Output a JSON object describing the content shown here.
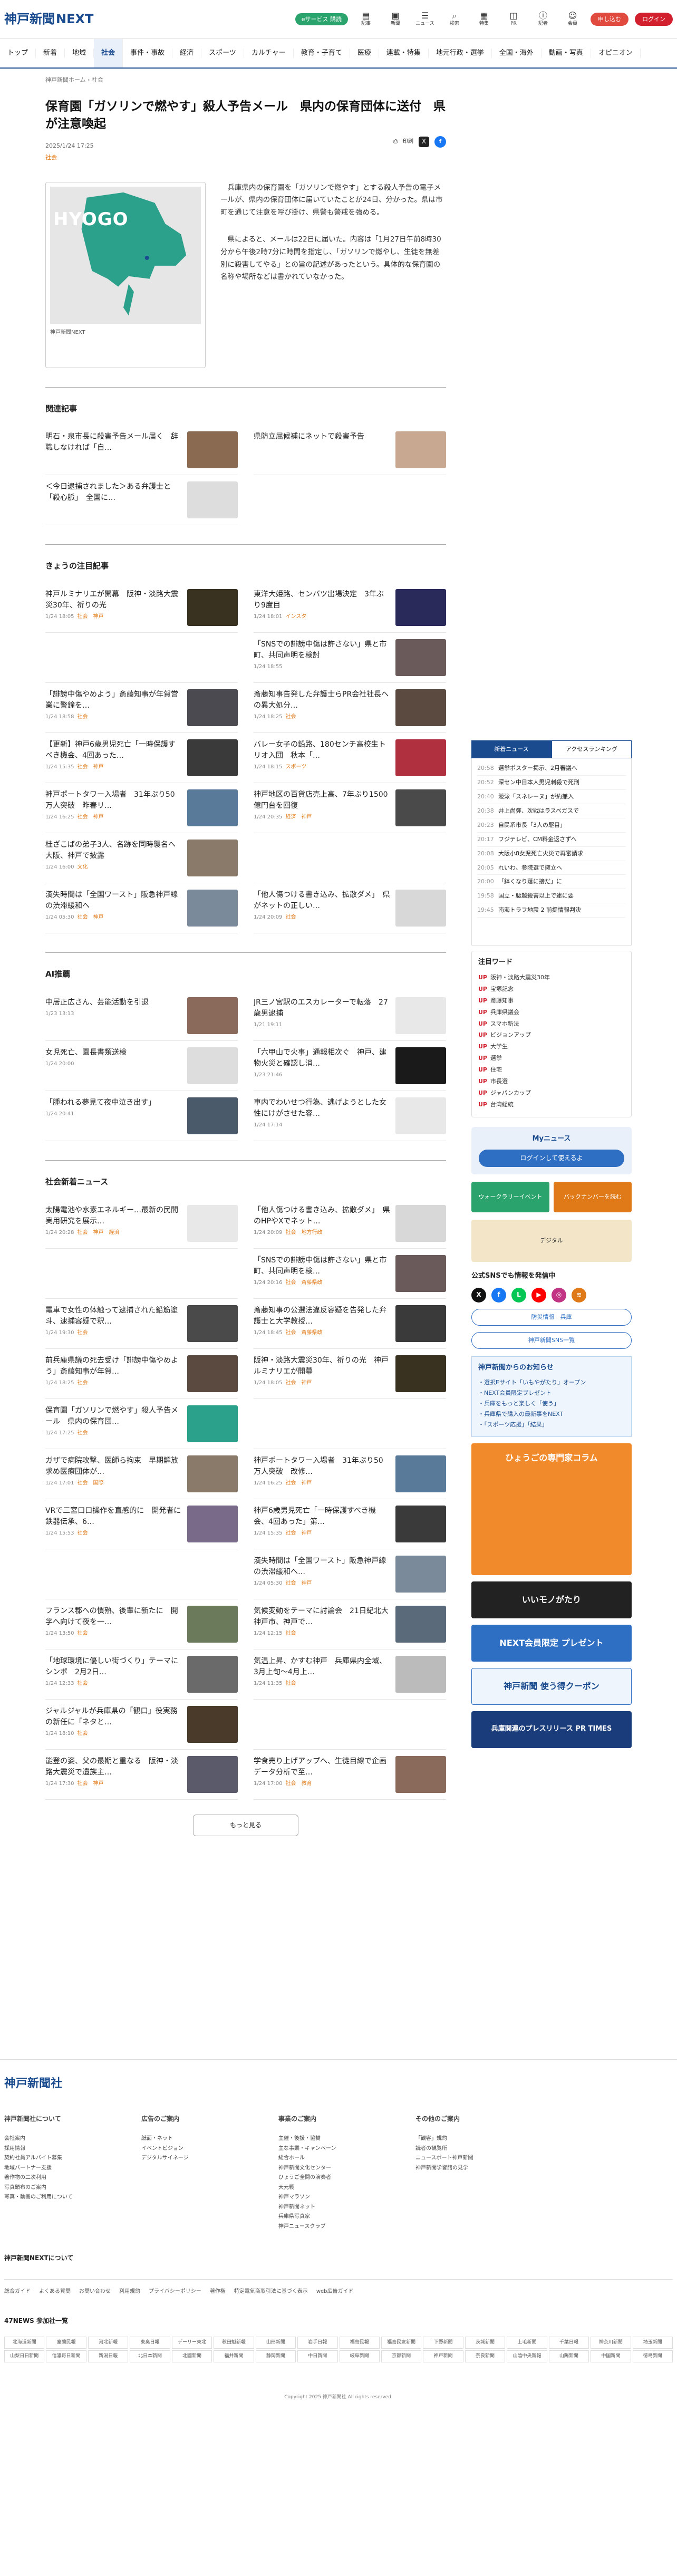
{
  "site": {
    "logo_jp": "神戸新聞",
    "logo_en": "NEXT",
    "eservice": "eサービス 購読"
  },
  "header_icons": [
    "記事",
    "新聞",
    "ニュース",
    "検索",
    "特集",
    "PR",
    "記者",
    "会員"
  ],
  "header_labels": {
    "subscribe": "申し込む",
    "login": "ログイン"
  },
  "nav": [
    "トップ",
    "新着",
    "地域",
    "社会",
    "事件・事故",
    "経済",
    "スポーツ",
    "カルチャー",
    "教育・子育て",
    "医療",
    "連載・特集",
    "地元行政・選挙",
    "全国・海外",
    "動画・写真",
    "オピニオン"
  ],
  "breadcrumb": "神戸新聞ホーム › 社会",
  "article": {
    "title": "保育園「ガソリンで燃やす」殺人予告メール　県内の保育団体に送付　県が注意喚起",
    "date": "2025/1/24 17:25",
    "category": "社会",
    "map_label": "HYOGO",
    "caption": "神戸新聞NEXT",
    "p1": "兵庫県内の保育園を「ガソリンで燃やす」とする殺人予告の電子メールが、県内の保育団体に届いていたことが24日、分かった。県は市町を通じて注意を呼び掛け、県警も警戒を強める。",
    "p2": "県によると、メールは22日に届いた。内容は「1月27日午前8時30分から午後2時7分に時間を指定し、「ガソリンで燃やし、生徒を無差別に殺害してやる」との旨の記述があったという。具体的な保育園の名称や場所などは書かれていなかった。"
  },
  "share_labels": {
    "print": "印刷",
    "x": "X",
    "fb": "f"
  },
  "sections": {
    "related": "関連記事",
    "today": "きょうの注目記事",
    "ai": "AI推薦",
    "social": "社会新着ニュース"
  },
  "related": [
    {
      "title": "明石・泉市長に殺害予告メール届く　辞職しなければ「自…",
      "meta": "",
      "thumb": "#8a6a50"
    },
    {
      "title": "県防立屈候補にネットで殺害予告",
      "meta": "",
      "thumb": "#c8a890"
    },
    {
      "title": "＜今日逮捕されました＞ある弁護士と「殺心脈」　全国に…",
      "meta": "",
      "thumb": "#dddddd"
    }
  ],
  "today": [
    {
      "title": "神戸ルミナリエが開幕　阪神・淡路大震災30年、祈りの光",
      "meta": "1/24 18:05",
      "cat": "社会　神戸",
      "thumb": "#3a3220"
    },
    {
      "title": "東洋大姫路、センバツ出場決定　3年ぶり9度目",
      "meta": "1/24 18:01",
      "cat": "インスタ",
      "thumb": "#2a2a5a"
    },
    {
      "title": "",
      "meta": "",
      "cat": "",
      "thumb": ""
    },
    {
      "title": "「SNSでの誹謗中傷は許さない」県と市町、共同声明を検討",
      "meta": "1/24 18:55",
      "cat": "",
      "thumb": "#6a5a5a"
    },
    {
      "title": "「誹謗中傷やめよう」斎藤知事が年賀営業に警鐘を…",
      "meta": "1/24 18:58",
      "cat": "社会",
      "thumb": "#4a4a50"
    },
    {
      "title": "斎藤知事告発した弁護士らPR会社社長への異大処分…",
      "meta": "1/24 18:25",
      "cat": "社会",
      "thumb": "#5a4a40"
    },
    {
      "title": "【更新】神戸6歳男児死亡「一時保護すべき機会、4回あった…",
      "meta": "1/24 15:35",
      "cat": "社会　神戸",
      "thumb": "#3a3a3a"
    },
    {
      "title": "バレー女子の鉛路、180センチ高校生トリオ入団　秋本「…",
      "meta": "1/24 18:15",
      "cat": "スポーツ",
      "thumb": "#b03040"
    },
    {
      "title": "神戸ポートタワー入場者　31年ぶり50万人突破　昨春リ…",
      "meta": "1/24 16:25",
      "cat": "社会　神戸",
      "thumb": "#5a7a9a"
    },
    {
      "title": "神戸地区の百貨店売上高、7年ぶり1500億円台を回復",
      "meta": "1/24 20:35",
      "cat": "経済　神戸",
      "thumb": "#4a4a4a"
    },
    {
      "title": "桂ざこばの弟子3人、名跡を同時襲名へ　大阪、神戸で披露",
      "meta": "1/24 16:00",
      "cat": "文化",
      "thumb": "#8a7a6a"
    },
    {
      "title": "",
      "meta": "",
      "cat": "",
      "thumb": ""
    },
    {
      "title": "漢失時間は「全国ワースト」阪急神戸線の渋滞緩和へ",
      "meta": "1/24 05:30",
      "cat": "社会　神戸",
      "thumb": "#7a8a9a"
    },
    {
      "title": "「他人傷つける書き込み、拡散ダメ」　県がネットの正しい…",
      "meta": "1/24 20:09",
      "cat": "社会",
      "thumb": "#d8d8d8"
    }
  ],
  "ai": [
    {
      "title": "中居正広さん、芸能活動を引退",
      "meta": "1/23 13:13",
      "cat": "",
      "thumb": "#8a6a5a"
    },
    {
      "title": "JR三ノ宮駅のエスカレーターで転落　27歳男逮捕",
      "meta": "1/21 19:11",
      "cat": "",
      "thumb": "#e8e8e8"
    },
    {
      "title": "女児死亡、園長書類送検",
      "meta": "1/24 20:00",
      "cat": "",
      "thumb": "#dddddd"
    },
    {
      "title": "「六甲山で火事」通報相次ぐ　神戸、建物火災と確認し消…",
      "meta": "1/23 21:46",
      "cat": "",
      "thumb": "#1a1a1a"
    },
    {
      "title": "「腫われる夢見て夜中泣き出す」",
      "meta": "1/24 20:41",
      "cat": "",
      "thumb": "#4a5a6a"
    },
    {
      "title": "車内でわいせつ行為、逃げようとした女性にけがさせた容…",
      "meta": "1/24 17:14",
      "cat": "",
      "thumb": "#e8e8e8"
    }
  ],
  "social": [
    {
      "title": "太陽電池や水素エネルギー…最新の民間実用研究を展示…",
      "meta": "1/24 20:28",
      "cat": "社会　神戸　経済",
      "thumb": "#e8e8e8"
    },
    {
      "title": "「他人傷つける書き込み、拡散ダメ」　県のHPやXでネット…",
      "meta": "1/24 20:09",
      "cat": "社会　地方行政",
      "thumb": "#d8d8d8"
    },
    {
      "title": "",
      "meta": "",
      "cat": "",
      "thumb": ""
    },
    {
      "title": "「SNSでの誹謗中傷は許さない」県と市町、共同声明を検…",
      "meta": "1/24 20:16",
      "cat": "社会　斎藤県政",
      "thumb": "#6a5a5a"
    },
    {
      "title": "電車で女性の体触って逮捕された鉛筋塗斗、逮捕容疑で釈…",
      "meta": "1/24 19:30",
      "cat": "社会",
      "thumb": "#4a4a4a"
    },
    {
      "title": "斎藤知事の公選法違反容疑を告発した弁護士と大学教授…",
      "meta": "1/24 18:45",
      "cat": "社会　斎藤県政",
      "thumb": "#3a3a3a"
    },
    {
      "title": "前兵庫県議の死去受け「誹謗中傷やめよう」斎藤知事が年賀…",
      "meta": "1/24 18:25",
      "cat": "社会",
      "thumb": "#5a4a40"
    },
    {
      "title": "阪神・淡路大震災30年、祈りの光　神戸ルミナリエが開幕",
      "meta": "1/24 18:05",
      "cat": "社会　神戸",
      "thumb": "#3a3220"
    },
    {
      "title": "保育園「ガソリンで燃やす」殺人予告メール　県内の保育団…",
      "meta": "1/24 17:25",
      "cat": "社会",
      "thumb": "#2ba08a"
    },
    {
      "title": "",
      "meta": "",
      "cat": "",
      "thumb": ""
    },
    {
      "title": "ガザで病院攻撃、医師ら拘束　早期解放求め医療団体が…",
      "meta": "1/24 17:01",
      "cat": "社会　国際",
      "thumb": "#8a7a6a"
    },
    {
      "title": "神戸ポートタワー入場者　31年ぶり50万人突破　改修…",
      "meta": "1/24 16:25",
      "cat": "社会　神戸",
      "thumb": "#5a7a9a"
    },
    {
      "title": "VRで三宮口口操作を直感的に　開発者に鉄器伝承、6…",
      "meta": "1/24 15:53",
      "cat": "社会",
      "thumb": "#7a6a8a"
    },
    {
      "title": "神戸6歳男児死亡「一時保護すべき機会、4回あった」第…",
      "meta": "1/24 15:35",
      "cat": "社会　神戸",
      "thumb": "#3a3a3a"
    },
    {
      "title": "",
      "meta": "",
      "cat": "",
      "thumb": ""
    },
    {
      "title": "漢失時間は「全国ワースト」阪急神戸線の渋滞緩和へ…",
      "meta": "1/24 05:30",
      "cat": "社会　神戸",
      "thumb": "#7a8a9a"
    },
    {
      "title": "フランス郡への慣熟、後輩に新たに　開学へ向けて夜を一…",
      "meta": "1/24 13:50",
      "cat": "社会",
      "thumb": "#6a7a5a"
    },
    {
      "title": "気候変動をテーマに討論会　21日紀北大神戸市、神戸で…",
      "meta": "1/24 12:15",
      "cat": "社会",
      "thumb": "#5a6a7a"
    },
    {
      "title": "「地球環境に優しい街づくり」テーマにシンポ　2月2日…",
      "meta": "1/24 12:33",
      "cat": "社会",
      "thumb": "#6a6a6a"
    },
    {
      "title": "気温上昇、かすむ神戸　兵庫県内全域、3月上旬〜4月上…",
      "meta": "1/24 11:35",
      "cat": "社会",
      "thumb": "#bbbbbb"
    },
    {
      "title": "ジャルジャルが兵庫県の「観口」役実務の新任に「ネタと…",
      "meta": "1/24 18:10",
      "cat": "社会",
      "thumb": "#4a3a2a"
    },
    {
      "title": "",
      "meta": "",
      "cat": "",
      "thumb": ""
    },
    {
      "title": "能登の姿、父の最期と重なる　阪神・淡路大震災で遺族主…",
      "meta": "1/24 17:30",
      "cat": "社会　神戸",
      "thumb": "#5a5a6a"
    },
    {
      "title": "学食売り上げアップへ、生徒目線で企画　データ分析で至…",
      "meta": "1/24 17:00",
      "cat": "社会　教育",
      "thumb": "#8a6a5a"
    }
  ],
  "more_label": "もっと見る",
  "side": {
    "tabs": [
      "新着ニュース",
      "アクセスランキング"
    ],
    "rank": [
      [
        "20:58",
        "選挙ポスター掲示、2月審議へ"
      ],
      [
        "20:52",
        "深セン中日本人男児刺殺で死刑"
      ],
      [
        "20:40",
        "競泳「スネレーヌ」が約兼入"
      ],
      [
        "20:38",
        "井上尚弥、次戦はラスベガスで"
      ],
      [
        "20:23",
        "自民系市長「3人の駆目」"
      ],
      [
        "20:17",
        "フジテレビ、CM料金返さずへ"
      ],
      [
        "20:08",
        "大阪小8女児死亡火災で再審請求"
      ],
      [
        "20:05",
        "れいわ、参院選で擁立へ"
      ],
      [
        "20:00",
        "「鉢くなり落に接だ」に"
      ],
      [
        "19:58",
        "国立・腰越殺害以上で逮に要"
      ],
      [
        "19:45",
        "南海トラフ地震 2 前提情報判決"
      ]
    ],
    "words_title": "注目ワード",
    "words": [
      "阪神・淡路大震災30年",
      "宝塚記念",
      "斎藤知事",
      "兵庫県議会",
      "スマホ新法",
      "ビジョンアップ",
      "大学生",
      "選挙",
      "住宅",
      "市長選",
      "ジャパンカップ",
      "台湾総統"
    ],
    "mynews_title": "Myニュース",
    "mynews_btn": "ログインして使えるよ",
    "promo": [
      "ウォークラリーイベント",
      "バックナンバーを読む",
      "デジタル"
    ],
    "sns_title": "公式SNSでも情報を発信中",
    "sns_btns": [
      "防災情報　兵庫",
      "神戸新聞SNS一覧"
    ],
    "info_title": "神戸新聞からのお知らせ",
    "info": [
      "・選択Eサイト「いもやがたり」オープン",
      "・NEXT会員限定プレゼント",
      "・兵庫をもっと楽しく「使う」",
      "・兵庫県で購入の最新事をNEXT",
      "・「スポーツ応援」「結果」"
    ],
    "banners": [
      "ひょうごの専門家コラム",
      "いいモノがたり",
      "NEXT会員限定 プレゼント",
      "神戸新聞 使う得クーポン",
      "兵庫関連のプレスリリース PR TIMES"
    ]
  },
  "footer": {
    "logo": "神戸新聞社",
    "cols": [
      {
        "h": "神戸新聞社について",
        "items": [
          "会社案内",
          "採用情報",
          "契約社員アルバイト募集",
          "地域パートナー支援",
          "著作物の二次利用",
          "写真頒布のご案内",
          "写真・動画のご利用について"
        ]
      },
      {
        "h": "広告のご案内",
        "items": [
          "紙面・ネット",
          "イベントビジョン",
          "デジタルサイネージ"
        ]
      },
      {
        "h": "事業のご案内",
        "items": [
          "主催・後援・協賛",
          "主な事業・キャンペーン",
          "総合ホール",
          "神戸新聞文化センター",
          "ひょうご全関の演奏者",
          "天元戦",
          "神戸マラソン",
          "神戸新聞ネット",
          "兵庫県写真家",
          "神戸ニュースクラブ"
        ]
      },
      {
        "h": "その他のご案内",
        "items": [
          "「観客」規約",
          "読者の観覧所",
          "ニュースポート神戸新聞",
          "神戸新聞学習館の見学"
        ]
      }
    ],
    "bar": [
      "総合ガイド",
      "よくある質問",
      "お問い合わせ",
      "利用規約",
      "プライバシーポリシー",
      "著作権",
      "特定電気商取引法に基づく表示",
      "web広告ガイド"
    ],
    "net": "神戸新聞NEXTについて",
    "news47": "47NEWS 参加社一覧",
    "papers": [
      "北海道新聞",
      "室蘭民報",
      "河北新報",
      "東奥日報",
      "デーリー東北",
      "秋田魁新報",
      "山形新聞",
      "岩手日報",
      "福島民報",
      "福島民友新聞",
      "下野新聞",
      "茨城新聞",
      "上毛新聞",
      "千葉日報",
      "神奈川新聞",
      "埼玉新聞",
      "山梨日日新聞",
      "信濃毎日新聞",
      "新潟日報",
      "北日本新聞",
      "北國新聞",
      "福井新聞",
      "静岡新聞",
      "中日新聞",
      "岐阜新聞",
      "京都新聞",
      "神戸新聞",
      "奈良新聞",
      "山陰中央新報",
      "山陽新聞",
      "中国新聞",
      "徳島新聞"
    ],
    "copyright": "Copyright 2025 神戸新聞社 All rights reserved."
  }
}
